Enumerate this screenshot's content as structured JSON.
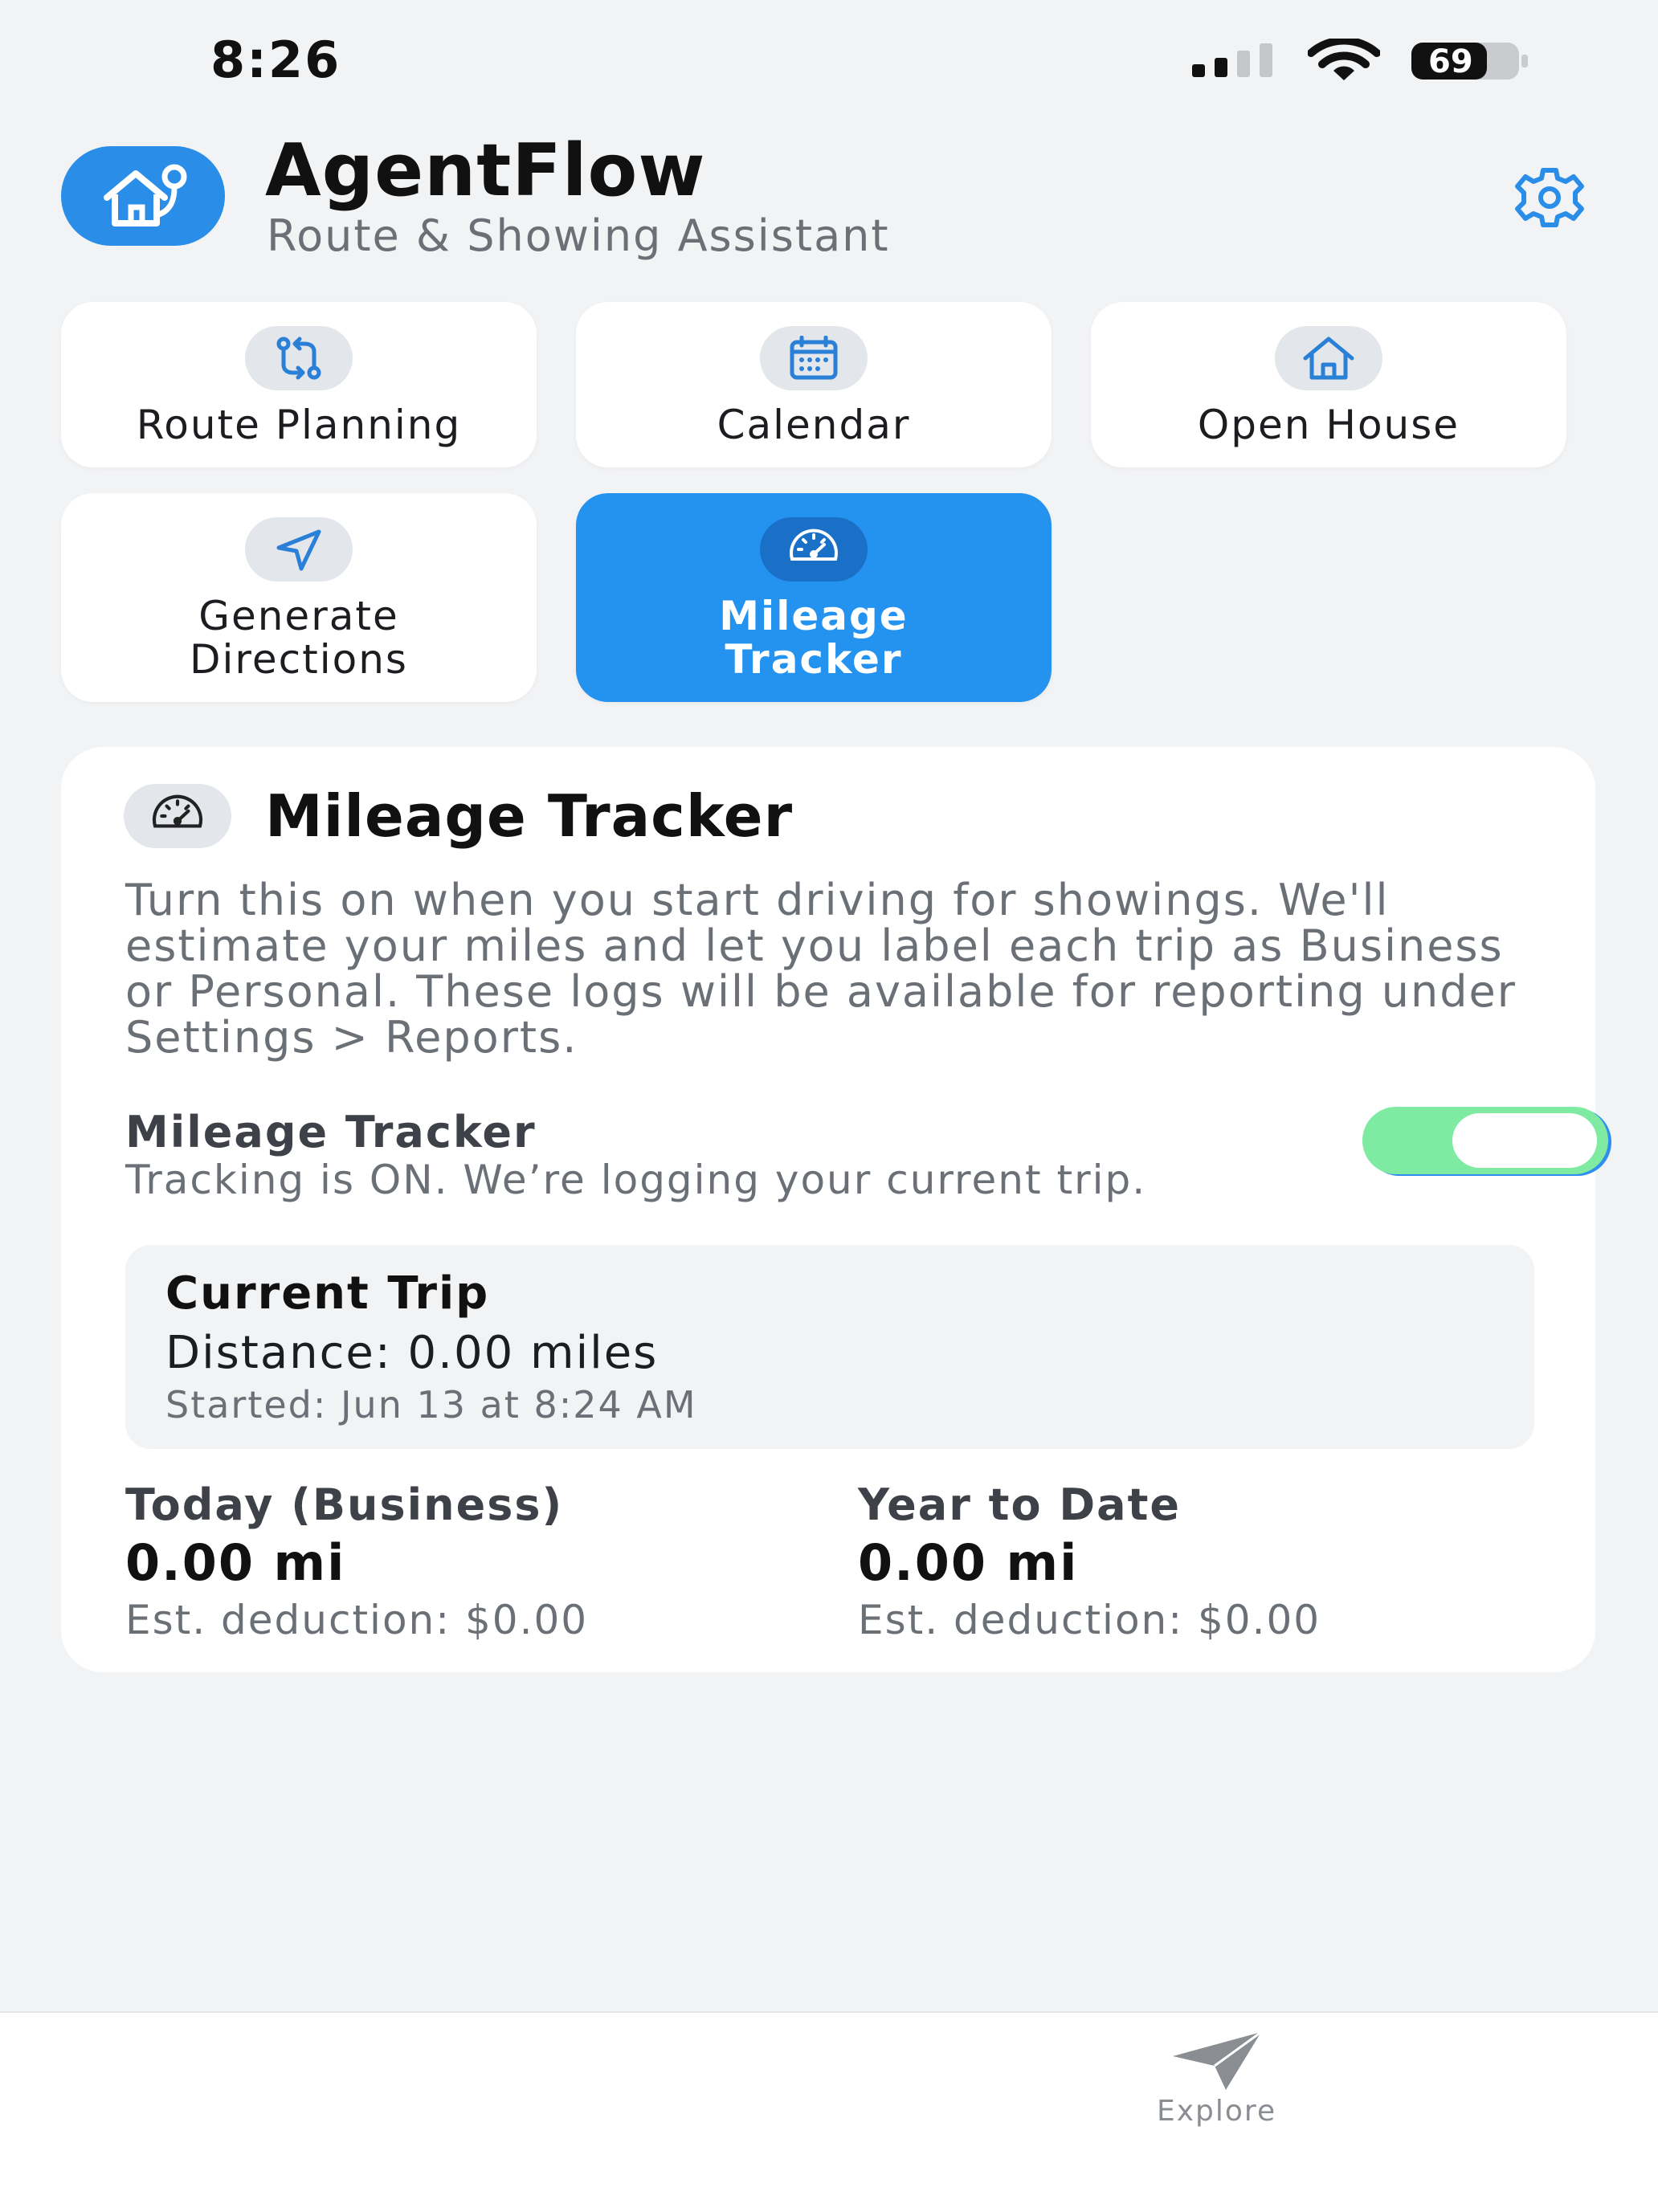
{
  "status_bar": {
    "time": "8:26",
    "battery": "69"
  },
  "header": {
    "title": "AgentFlow",
    "subtitle": "Route & Showing Assistant"
  },
  "tiles": [
    {
      "label": "Route Planning",
      "icon": "route-arrows-icon",
      "active": false
    },
    {
      "label": "Calendar",
      "icon": "calendar-icon",
      "active": false
    },
    {
      "label": "Open House",
      "icon": "house-icon",
      "active": false
    },
    {
      "label": "Generate\nDirections",
      "icon": "navigation-arrow-icon",
      "active": false
    },
    {
      "label": "Mileage\nTracker",
      "icon": "speedometer-icon",
      "active": true
    }
  ],
  "mileage": {
    "title": "Mileage Tracker",
    "description": "Turn this on when you start driving for showings. We'll estimate your miles and let you label each trip as Business or Personal. These logs will be available for reporting under Settings > Reports.",
    "toggle_label": "Mileage Tracker",
    "toggle_status": "Tracking is ON. We’re logging your current trip.",
    "toggle_on": true,
    "current_trip": {
      "title": "Current Trip",
      "distance": "Distance: 0.00 miles",
      "started": "Started: Jun 13 at 8:24 AM"
    },
    "today": {
      "label": "Today (Business)",
      "value": "0.00 mi",
      "deduction": "Est. deduction: $0.00"
    },
    "ytd": {
      "label": "Year to Date",
      "value": "0.00 mi",
      "deduction": "Est. deduction: $0.00"
    }
  },
  "tabbar": {
    "explore_label": "Explore"
  },
  "colors": {
    "accent": "#2492ef",
    "toggle_on": "#7feaa1",
    "background": "#f2f3f5"
  }
}
